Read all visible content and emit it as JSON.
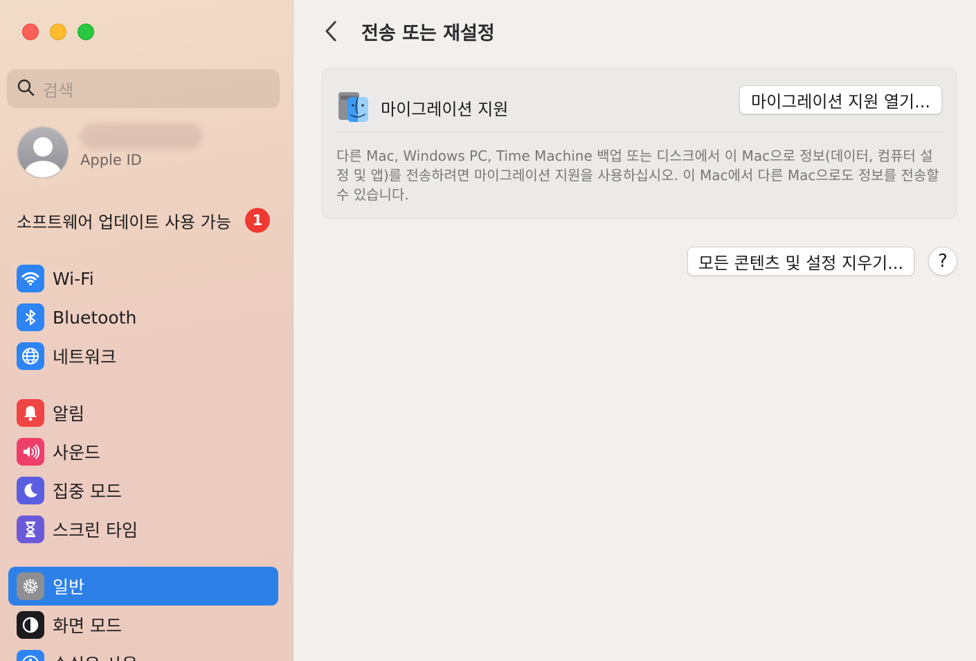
{
  "sidebar": {
    "search_placeholder": "검색",
    "account_label": "Apple ID",
    "update_label": "소프트웨어 업데이트 사용 가능",
    "update_count": "1",
    "items": [
      {
        "label": "Wi-Fi",
        "icon": "wifi-icon",
        "color": "#2d84f5"
      },
      {
        "label": "Bluetooth",
        "icon": "bluetooth-icon",
        "color": "#2d84f5"
      },
      {
        "label": "네트워크",
        "icon": "globe-icon",
        "color": "#2d84f5"
      },
      {
        "label": "알림",
        "icon": "bell-icon",
        "color": "#f04545"
      },
      {
        "label": "사운드",
        "icon": "speaker-icon",
        "color": "#ee3e6a"
      },
      {
        "label": "집중 모드",
        "icon": "moon-icon",
        "color": "#5b5ee0"
      },
      {
        "label": "스크린 타임",
        "icon": "hourglass-icon",
        "color": "#6a5ad8"
      },
      {
        "label": "일반",
        "icon": "gear-icon",
        "color": "#8e8e93",
        "selected": true
      },
      {
        "label": "화면 모드",
        "icon": "appearance-icon",
        "color": "#1c1c1e"
      },
      {
        "label": "손쉬운 사용",
        "icon": "accessibility-icon",
        "color": "#2d84f5"
      }
    ]
  },
  "main": {
    "title": "전송 또는 재설정",
    "migration": {
      "label": "마이그레이션 지원",
      "open_button": "마이그레이션 지원 열기...",
      "description": "다른 Mac, Windows PC, Time Machine 백업 또는 디스크에서 이 Mac으로 정보(데이터, 컴퓨터 설정 및 앱)를 전송하려면 마이그레이션 지원을 사용하십시오. 이 Mac에서 다른 Mac으로도 정보를 전송할 수 있습니다."
    },
    "reset_button": "모든 콘텐츠 및 설정 지우기...",
    "help_button": "?"
  }
}
